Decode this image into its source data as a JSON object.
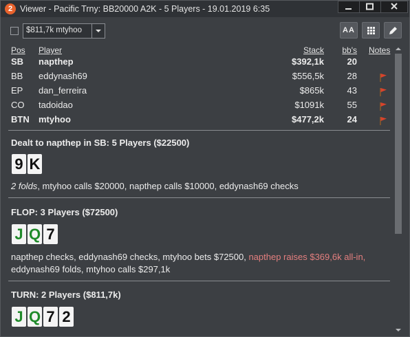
{
  "window": {
    "title": "Viewer - Pacific Trny: BB20000 A2K - 5 Players - 19.01.2019 6:35",
    "app_badge": "2"
  },
  "toolbar": {
    "hand_select_value": "$811,7k mtyhoo",
    "font_button_label": "AA"
  },
  "table": {
    "headers": {
      "pos": "Pos",
      "player": "Player",
      "stack": "Stack",
      "bbs": "bb's",
      "notes": "Notes"
    },
    "rows": [
      {
        "pos": "SB",
        "player": "napthep",
        "stack": "$392,1k",
        "bbs": "20",
        "bold": true,
        "note_flag": false
      },
      {
        "pos": "BB",
        "player": "eddynash69",
        "stack": "$556,5k",
        "bbs": "28",
        "bold": false,
        "note_flag": true
      },
      {
        "pos": "EP",
        "player": "dan_ferreira",
        "stack": "$865k",
        "bbs": "43",
        "bold": false,
        "note_flag": true
      },
      {
        "pos": "CO",
        "player": "tadoidao",
        "stack": "$1091k",
        "bbs": "55",
        "bold": false,
        "note_flag": true
      },
      {
        "pos": "BTN",
        "player": "mtyhoo",
        "stack": "$477,2k",
        "bbs": "24",
        "bold": true,
        "note_flag": true
      }
    ]
  },
  "colors": {
    "flag": "#d9432b",
    "club_green": "#1f8a2a",
    "spade_black": "#111111",
    "raise_text": "#e47f7f"
  },
  "streets": [
    {
      "title": "Dealt to napthep in SB: 5 Players ($22500)",
      "cards": [
        {
          "rank": "9",
          "suit": "spade"
        },
        {
          "rank": "K",
          "suit": "spade"
        }
      ],
      "actions": {
        "folds": "2 folds",
        "rest": ", mtyhoo calls $20000, napthep calls $10000, eddynash69 checks"
      }
    },
    {
      "title": "FLOP: 3 Players ($72500)",
      "cards": [
        {
          "rank": "J",
          "suit": "club"
        },
        {
          "rank": "Q",
          "suit": "club"
        },
        {
          "rank": "7",
          "suit": "spade"
        }
      ],
      "actions": {
        "line1": "napthep checks, eddynash69 checks, mtyhoo bets $72500, ",
        "raise": "napthep raises $369,6k all-in,",
        "line2": "eddynash69 folds, mtyhoo calls $297,1k"
      }
    },
    {
      "title": "TURN: 2 Players ($811,7k)",
      "cards": [
        {
          "rank": "J",
          "suit": "club"
        },
        {
          "rank": "Q",
          "suit": "club"
        },
        {
          "rank": "7",
          "suit": "spade"
        },
        {
          "rank": "2",
          "suit": "spade"
        }
      ]
    }
  ]
}
